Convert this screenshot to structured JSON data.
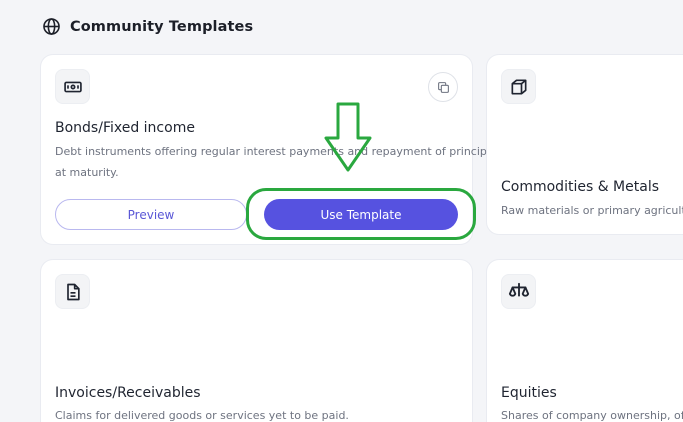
{
  "section": {
    "title": "Community Templates",
    "icon": "globe-icon"
  },
  "cards": [
    {
      "title": "Bonds/Fixed income",
      "description_line1": "Debt instruments offering regular interest payments and repayment of principal",
      "description_line2": "at maturity.",
      "icon": "banknote-icon",
      "preview_label": "Preview",
      "use_label": "Use Template"
    },
    {
      "title": "Commodities & Metals",
      "description": "Raw materials or primary agricultural",
      "icon": "cube-icon"
    },
    {
      "title": "Invoices/Receivables",
      "description": "Claims for delivered goods or services yet to be paid.",
      "icon": "document-icon"
    },
    {
      "title": "Equities",
      "description": "Shares of company ownership, offeri",
      "icon": "scale-icon"
    }
  ],
  "colors": {
    "accent": "#5652e0",
    "annotation": "#2aa83f",
    "background": "#f4f5f8"
  }
}
